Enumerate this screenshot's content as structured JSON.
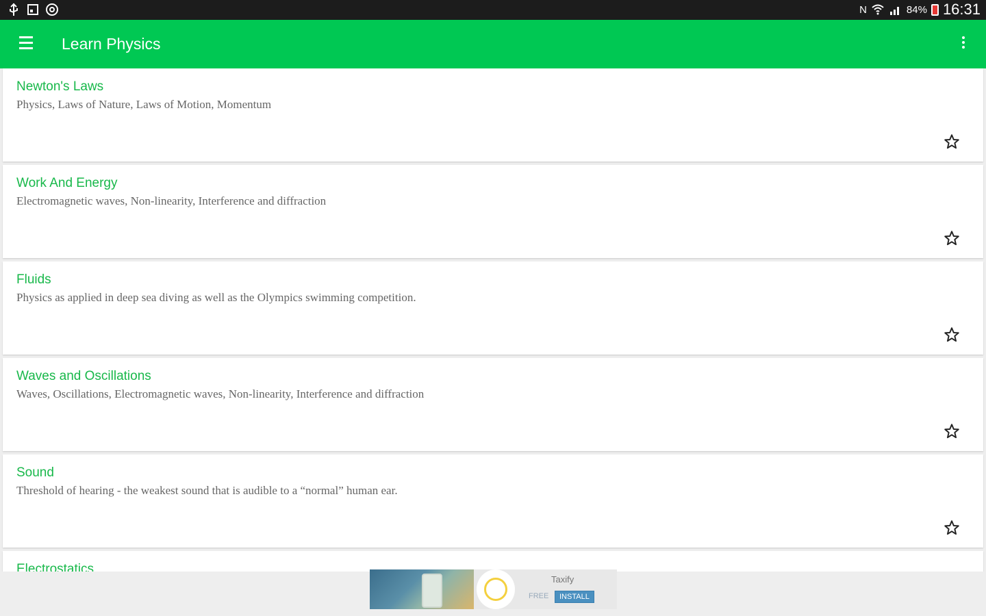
{
  "status_bar": {
    "left_icons": [
      "usb-icon",
      "sd-card-icon",
      "sync-icon"
    ],
    "battery_percent": "84%",
    "time": "16:31",
    "right_icons": [
      "nfc-icon",
      "wifi-icon",
      "signal-icon",
      "battery-icon"
    ]
  },
  "app_bar": {
    "title": "Learn Physics",
    "color": "#00c853"
  },
  "topics": [
    {
      "title": "Newton's Laws",
      "description": "Physics, Laws of Nature, Laws of Motion, Momentum"
    },
    {
      "title": "Work And Energy",
      "description": "Electromagnetic waves, Non-linearity, Interference and diffraction"
    },
    {
      "title": "Fluids",
      "description": "Physics as applied in deep sea diving as well as the Olympics swimming competition."
    },
    {
      "title": "Waves and Oscillations",
      "description": "Waves, Oscillations, Electromagnetic waves, Non-linearity, Interference and diffraction"
    },
    {
      "title": "Sound",
      "description": "Threshold of hearing - the weakest sound that is audible to a “normal” human ear."
    },
    {
      "title": "Electrostatics",
      "description": ""
    }
  ],
  "ad": {
    "app_name": "Taxify",
    "free_label": "FREE",
    "install_label": "INSTALL"
  }
}
